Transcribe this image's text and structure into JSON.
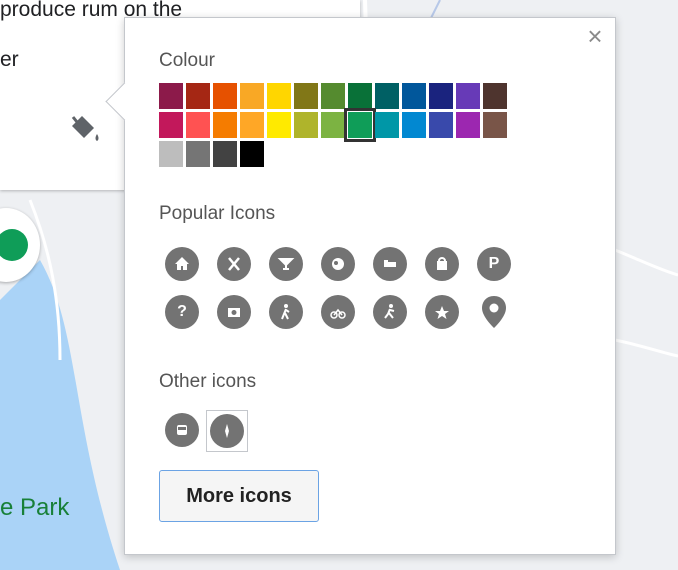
{
  "map": {
    "info_lines": [
      "produce rum on the",
      "er"
    ],
    "park_label": "e Park"
  },
  "dialog": {
    "close_label": "×",
    "colour_title": "Colour",
    "colour_rows": [
      [
        "#8c1a4a",
        "#a52714",
        "#e65100",
        "#f9a825",
        "#ffd600",
        "#817717",
        "#558b2f",
        "#097138",
        "#006064",
        "#01579b",
        "#1a237e",
        "#673ab7",
        "#4e342e"
      ],
      [
        "#c2185b",
        "#ff5252",
        "#f57c00",
        "#ffa726",
        "#ffea00",
        "#afb42b",
        "#7cb342",
        "#0f9d58",
        "#0097a7",
        "#0288d1",
        "#3949ab",
        "#9c27b0",
        "#795548"
      ],
      [
        "#bdbdbd",
        "#757575",
        "#424242",
        "#000000"
      ]
    ],
    "selected_colour": "#0f9d58",
    "popular_title": "Popular Icons",
    "popular_icons": [
      [
        "home-icon",
        "restaurant-icon",
        "bar-icon",
        "museum-icon",
        "hotel-icon",
        "shopping-icon",
        "parking-icon"
      ],
      [
        "help-icon",
        "camera-icon",
        "hiking-icon",
        "cycling-icon",
        "running-icon",
        "star-icon",
        "place-marker-icon"
      ]
    ],
    "parking_letter": "P",
    "help_letter": "?",
    "other_title": "Other icons",
    "other_icons": [
      "bus-icon",
      "compass-icon"
    ],
    "more_button_label": "More icons"
  }
}
